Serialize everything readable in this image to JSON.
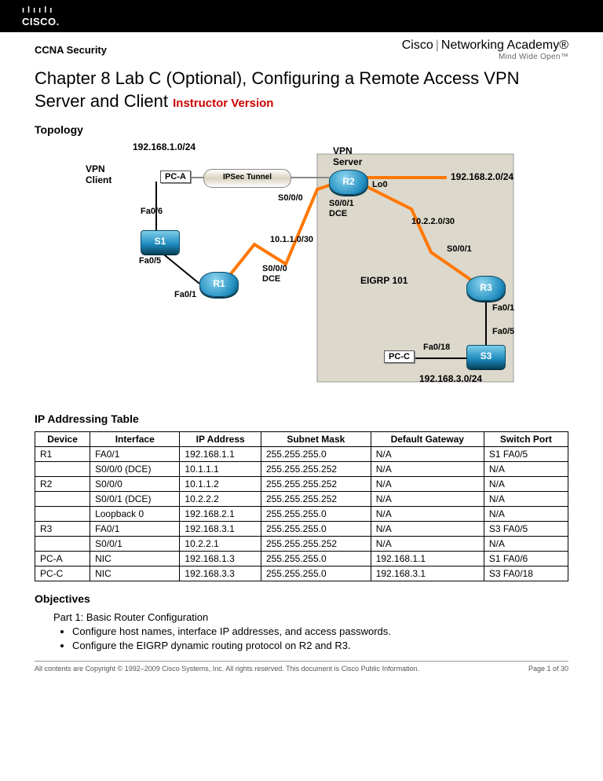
{
  "header": {
    "logo_bars": "ılıılı",
    "logo_text": "CISCO.",
    "course": "CCNA Security",
    "academy_main": "Cisco",
    "academy_sep": "|",
    "academy_rest": "Networking Academy®",
    "academy_sub": "Mind Wide Open™"
  },
  "title": {
    "main": "Chapter 8 Lab C (Optional), Configuring a Remote Access VPN Server and Client",
    "instructor": "Instructor Version"
  },
  "sections": {
    "topology": "Topology",
    "ip_table": "IP Addressing Table",
    "objectives": "Objectives"
  },
  "diagram": {
    "net1": "192.168.1.0/24",
    "net2": "192.168.2.0/24",
    "net3": "192.168.3.0/24",
    "net_1011": "10.1.1.0/30",
    "net_1022": "10.2.2.0/30",
    "vpn_client": "VPN\nClient",
    "vpn_server": "VPN\nServer",
    "eigrp": "EIGRP 101",
    "pca": "PC-A",
    "pcc": "PC-C",
    "s1": "S1",
    "s3": "S3",
    "r1": "R1",
    "r2": "R2",
    "r3": "R3",
    "tunnel": "IPSec Tunnel",
    "lo0": "Lo0",
    "fa06": "Fa0/6",
    "fa05a": "Fa0/5",
    "fa01a": "Fa0/1",
    "s000": "S0/0/0",
    "s000dce": "S0/0/0\nDCE",
    "s001dce": "S0/0/1\nDCE",
    "s001": "S0/0/1",
    "fa01b": "Fa0/1",
    "fa05b": "Fa0/5",
    "fa018": "Fa0/18"
  },
  "table": {
    "headers": [
      "Device",
      "Interface",
      "IP Address",
      "Subnet Mask",
      "Default Gateway",
      "Switch Port"
    ],
    "rows": [
      [
        "R1",
        "FA0/1",
        "192.168.1.1",
        "255.255.255.0",
        "N/A",
        "S1 FA0/5"
      ],
      [
        "",
        "S0/0/0 (DCE)",
        "10.1.1.1",
        "255.255.255.252",
        "N/A",
        "N/A"
      ],
      [
        "R2",
        "S0/0/0",
        "10.1.1.2",
        "255.255.255.252",
        "N/A",
        "N/A"
      ],
      [
        "",
        "S0/0/1 (DCE)",
        "10.2.2.2",
        "255.255.255.252",
        "N/A",
        "N/A"
      ],
      [
        "",
        "Loopback 0",
        "192.168.2.1",
        "255.255.255.0",
        "N/A",
        "N/A"
      ],
      [
        "R3",
        "FA0/1",
        "192.168.3.1",
        "255.255.255.0",
        "N/A",
        "S3 FA0/5"
      ],
      [
        "",
        "S0/0/1",
        "10.2.2.1",
        "255.255.255.252",
        "N/A",
        "N/A"
      ],
      [
        "PC-A",
        "NIC",
        "192.168.1.3",
        "255.255.255.0",
        "192.168.1.1",
        "S1 FA0/6"
      ],
      [
        "PC-C",
        "NIC",
        "192.168.3.3",
        "255.255.255.0",
        "192.168.3.1",
        "S3 FA0/18"
      ]
    ]
  },
  "objectives": {
    "part1": "Part 1: Basic Router Configuration",
    "b1": "Configure host names, interface IP addresses, and access passwords.",
    "b2": "Configure the EIGRP dynamic routing protocol on R2 and R3."
  },
  "footer": {
    "copyright": "All contents are Copyright © 1992–2009 Cisco Systems, Inc. All rights reserved. This document is Cisco Public Information.",
    "page": "Page 1 of 30"
  }
}
